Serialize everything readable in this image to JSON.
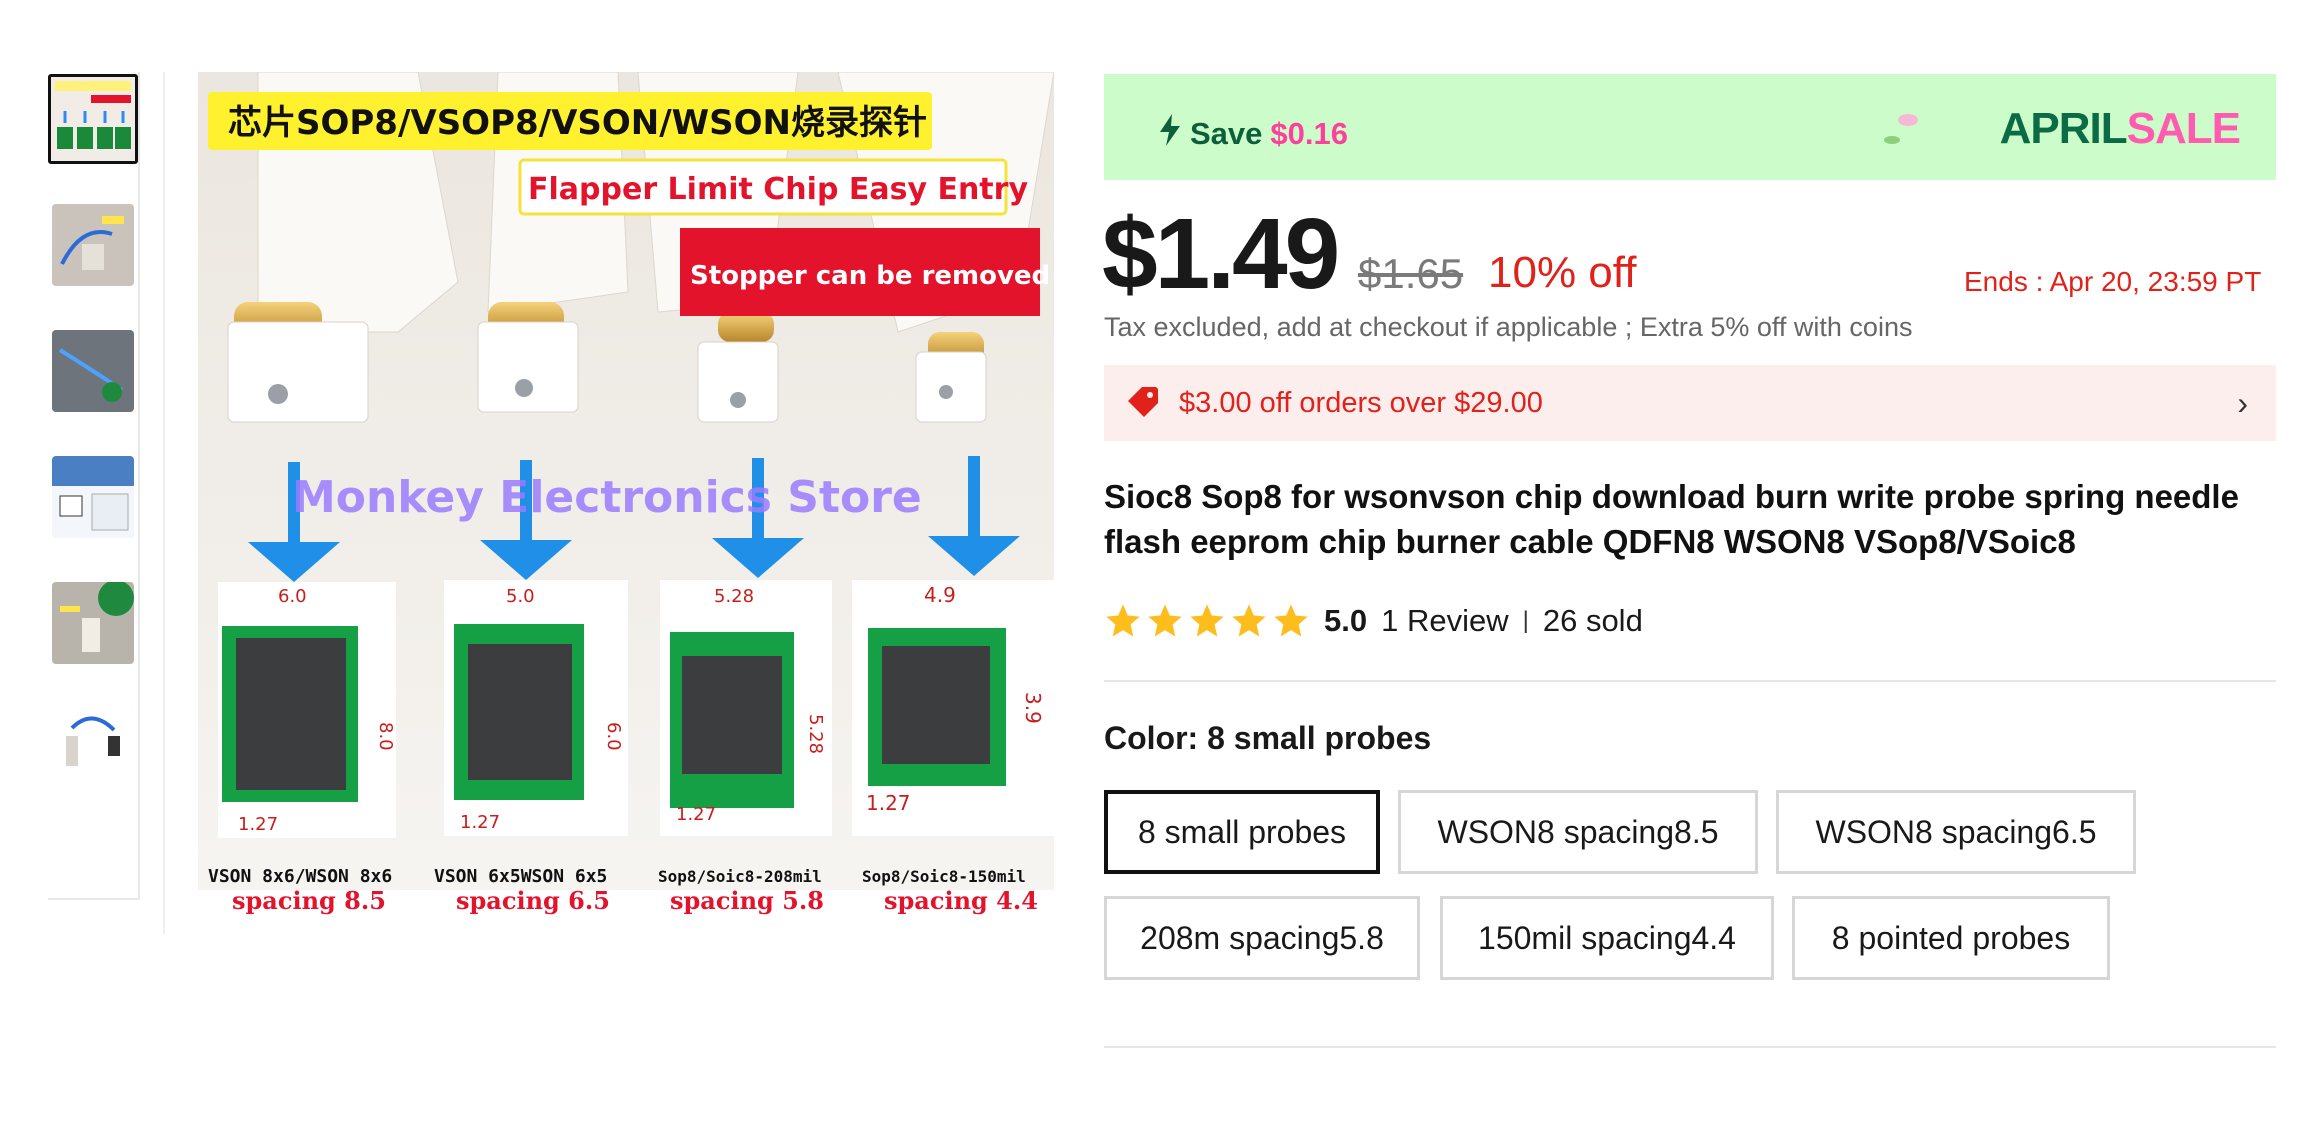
{
  "gallery": {
    "thumbnails": [
      "thumb-1",
      "thumb-2",
      "thumb-3",
      "thumb-4",
      "thumb-5",
      "thumb-6"
    ],
    "main_image": {
      "headline": "芯片SOP8/VSOP8/VSON/WSON烧录探针",
      "tag1": "Flapper Limit Chip Easy Entry",
      "tag2": "Stopper can be removed",
      "watermark": "Monkey Electronics Store",
      "chips": [
        {
          "label": "VSON 8x6/WSON 8x6",
          "spacing": "spacing 8.5",
          "dim_top": "6.0",
          "dim_side": "8.0",
          "pitch": "1.27"
        },
        {
          "label": "VSON 6x5WSON 6x5",
          "spacing": "spacing 6.5",
          "dim_top": "5.0",
          "dim_side": "6.0",
          "pitch": "1.27"
        },
        {
          "label": "Sop8/Soic8-208mil",
          "spacing": "spacing 5.8",
          "dim_top": "5.28",
          "dim_side": "5.28",
          "pitch": "1.27"
        },
        {
          "label": "Sop8/Soic8-150mil",
          "spacing": "spacing 4.4",
          "dim_top": "4.9",
          "dim_side": "3.9",
          "pitch": "1.27"
        }
      ]
    }
  },
  "banner": {
    "save_label": "Save",
    "save_amount": "$0.16",
    "sale_word1": "APRIL",
    "sale_word2": "SALE"
  },
  "pricing": {
    "price": "$1.49",
    "original_price": "$1.65",
    "discount": "10% off",
    "ends": "Ends :  Apr 20, 23:59 PT",
    "tax_note": "Tax excluded, add at checkout if applicable ; Extra 5% off with coins"
  },
  "coupon": {
    "text": "$3.00 off orders over $29.00",
    "chevron": "›"
  },
  "product": {
    "title": "Sioc8 Sop8 for wsonvson chip download burn write probe spring needle flash eeprom chip burner cable QDFN8 WSON8 VSop8/VSoic8"
  },
  "rating": {
    "stars": 5,
    "score": "5.0",
    "reviews": "1 Review",
    "separator": "|",
    "sold": "26 sold"
  },
  "color": {
    "label": "Color: ",
    "selected": "8 small probes",
    "options": [
      "8 small probes",
      "WSON8 spacing8.5",
      "WSON8 spacing6.5",
      "208m spacing5.8",
      "150mil spacing4.4",
      "8 pointed probes"
    ]
  },
  "colors": {
    "accent_red": "#e0221b",
    "banner_green": "#ccfcc9",
    "brand_green": "#0b6b45",
    "sale_pink": "#ff5cb0",
    "star_gold": "#fdbd1c"
  }
}
